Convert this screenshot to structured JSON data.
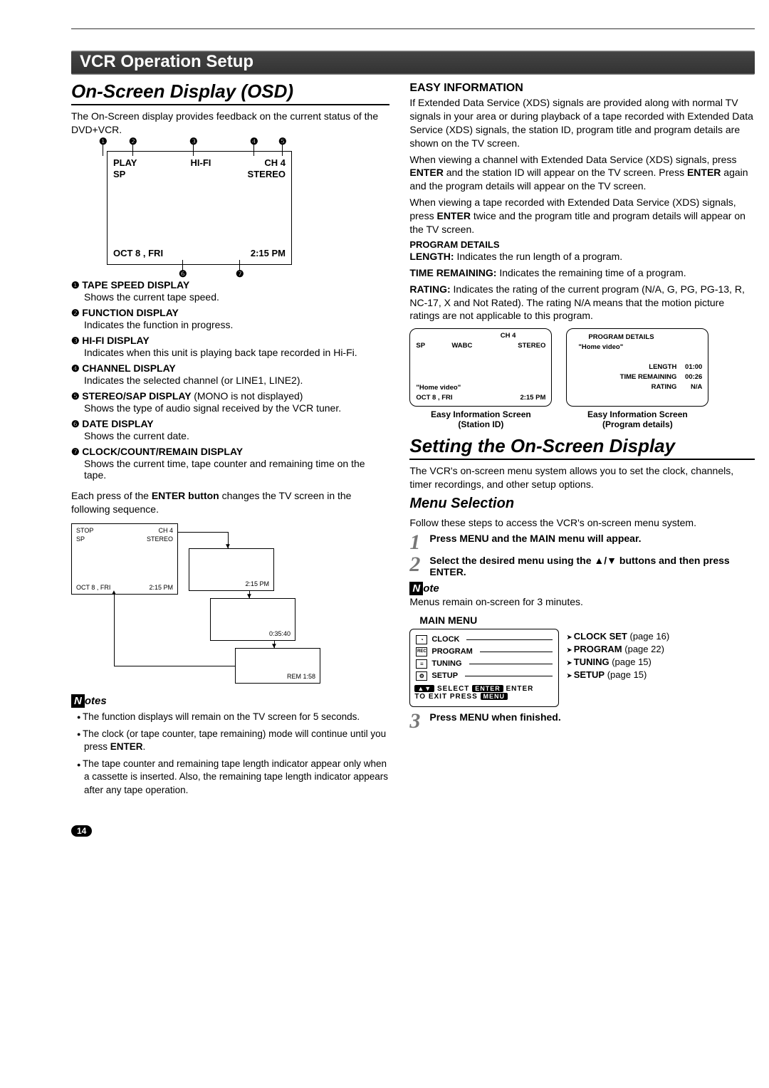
{
  "header_bar": "VCR Operation Setup",
  "left": {
    "h1": "On-Screen Display (OSD)",
    "intro": "The On-Screen display provides feedback on the current status of the DVD+VCR.",
    "osd": {
      "play": "PLAY",
      "hifi": "HI-FI",
      "ch": "CH  4",
      "sp": "SP",
      "stereo": "STEREO",
      "date": "OCT  8 ,  FRI",
      "time": "2:15 PM",
      "callouts": {
        "c1": "1",
        "c2": "2",
        "c3": "3",
        "c4": "4",
        "c5": "5",
        "c6": "6",
        "c7": "7"
      }
    },
    "defs": [
      {
        "num": "1",
        "title": "TAPE SPEED DISPLAY",
        "desc": "Shows the current tape speed."
      },
      {
        "num": "2",
        "title": "FUNCTION DISPLAY",
        "desc": "Indicates the function in progress."
      },
      {
        "num": "3",
        "title": "HI-FI DISPLAY",
        "desc": "Indicates when this unit is playing back tape recorded in Hi-Fi."
      },
      {
        "num": "4",
        "title": "CHANNEL DISPLAY",
        "desc": "Indicates the selected channel (or LINE1, LINE2)."
      },
      {
        "num": "5",
        "title": "STEREO/SAP DISPLAY",
        "desc_inline": "(MONO is not displayed)",
        "desc": "Shows the type of audio signal received by the VCR tuner."
      },
      {
        "num": "6",
        "title": "DATE DISPLAY",
        "desc": "Shows the current date."
      },
      {
        "num": "7",
        "title": "CLOCK/COUNT/REMAIN DISPLAY",
        "desc": "Shows the current time, tape counter and remaining time on the tape."
      }
    ],
    "enter_seq_pre": "Each press of the ",
    "enter_seq_bold": "ENTER button",
    "enter_seq_post": " changes the TV screen in the following sequence.",
    "seq": {
      "stop": "STOP",
      "sp": "SP",
      "ch": "CH  4",
      "stereo": "STEREO",
      "date": "OCT  8 ,  FRI",
      "time": "2:15 PM",
      "t2": "2:15 PM",
      "t3": "0:35:40",
      "t4": "REM 1:58"
    },
    "notes_label": "otes",
    "notes": [
      "The function displays will remain on the TV screen for 5 seconds.",
      "The clock (or tape counter, tape remaining) mode will continue until you press ENTER.",
      "The tape counter and remaining tape length indicator appear only when a cassette is inserted. Also, the remaining tape length indicator appears after any tape operation."
    ]
  },
  "right": {
    "easy_h": "EASY INFORMATION",
    "easy_p1": "If Extended Data Service (XDS) signals are provided along with normal TV signals in your area or during playback of a tape recorded with Extended Data Service (XDS) signals, the station ID, program title and program details are shown on the TV screen.",
    "easy_p2a": "When viewing a channel with Extended Data Service (XDS) signals, press ",
    "easy_p2b": " and the station ID will appear on the TV screen. Press ",
    "easy_p2c": " again and the program details will appear on the TV screen.",
    "easy_p3a": "When viewing a tape recorded with Extended  Data Service (XDS) signals, press ",
    "easy_p3b": " twice and the program title and program details will appear on the TV screen.",
    "enter": "ENTER",
    "prog_h": "PROGRAM DETAILS",
    "pd_len_l": "LENGTH:",
    "pd_len": " Indicates the run length of a program.",
    "pd_time_l": "TIME REMAINING:",
    "pd_time": " Indicates the remaining time of a program.",
    "pd_rating_l": "RATING:",
    "pd_rating": " Indicates the rating of the current program (N/A, G, PG, PG-13, R, NC-17, X and Not Rated). The rating N/A means that the motion picture ratings are not applicable to this program.",
    "scr1": {
      "ch": "CH  4",
      "sp": "SP",
      "wabc": "WABC",
      "stereo": "STEREO",
      "hv": "\"Home video\"",
      "date": "OCT   8 , FRI",
      "time": "2:15 PM",
      "cap": "Easy Information Screen",
      "cap2": "(Station ID)"
    },
    "scr2": {
      "title": "PROGRAM DETAILS",
      "hv": "\"Home video\"",
      "len_l": "LENGTH",
      "len": "01:00",
      "tr_l": "TIME REMAINING",
      "tr": "00:26",
      "rt_l": "RATING",
      "rt": "N/A",
      "cap": "Easy Information Screen",
      "cap2": "(Program details)"
    },
    "setting_h": "Setting the On-Screen Display",
    "setting_p": "The VCR's on-screen menu system allows you to set the clock, channels, timer recordings, and other setup options.",
    "menu_sel_h": "Menu Selection",
    "menu_sel_p": "Follow these steps to access the VCR's on-screen menu system.",
    "steps": [
      {
        "n": "1",
        "t": "Press MENU and the MAIN menu will appear."
      },
      {
        "n": "2",
        "t": "Select the desired menu using the ▲/▼ buttons and then press ENTER."
      }
    ],
    "note_label": "ote",
    "note_text": "Menus remain on-screen for 3 minutes.",
    "mm_h": "MAIN MENU",
    "mm_items": [
      {
        "label": "CLOCK",
        "target": "CLOCK SET",
        "page": "(page 16)"
      },
      {
        "label": "PROGRAM",
        "target": "PROGRAM",
        "page": "(page 22)"
      },
      {
        "label": "TUNING",
        "target": "TUNING",
        "page": "(page 15)"
      },
      {
        "label": "SETUP",
        "target": "SETUP",
        "page": "(page 15)"
      }
    ],
    "mm_foot_sel": "SELECT",
    "mm_foot_enter": "ENTER",
    "mm_foot_exit": "TO  EXIT PRESS",
    "mm_foot_menu": "MENU",
    "mm_foot_ab": "▲▼",
    "step3": {
      "n": "3",
      "t": "Press MENU when finished."
    }
  },
  "page_num": "14"
}
